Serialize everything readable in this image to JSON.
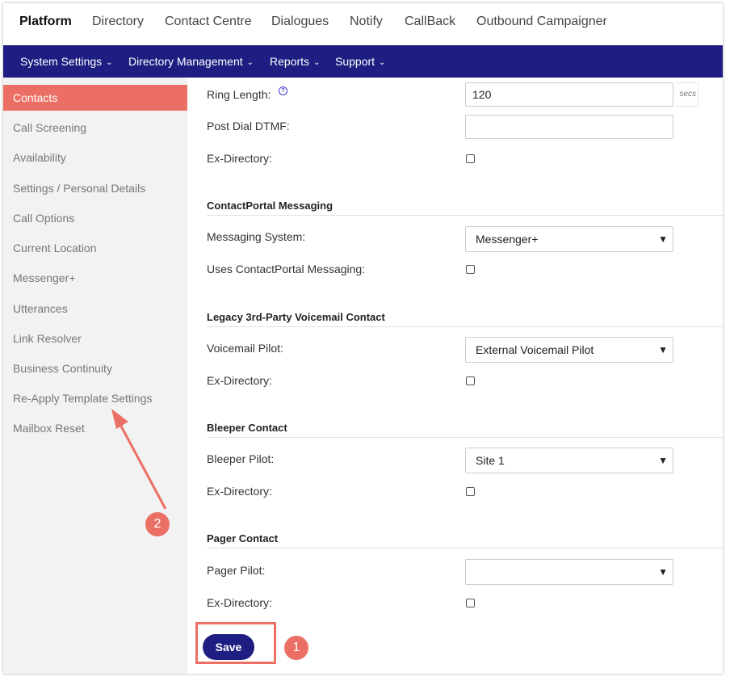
{
  "top_nav": [
    {
      "label": "Platform",
      "active": true
    },
    {
      "label": "Directory"
    },
    {
      "label": "Contact Centre"
    },
    {
      "label": "Dialogues"
    },
    {
      "label": "Notify"
    },
    {
      "label": "CallBack"
    },
    {
      "label": "Outbound Campaigner"
    }
  ],
  "sub_nav": [
    {
      "label": "System Settings"
    },
    {
      "label": "Directory Management"
    },
    {
      "label": "Reports"
    },
    {
      "label": "Support"
    }
  ],
  "sidebar": {
    "items": [
      {
        "label": "Contacts",
        "active": true
      },
      {
        "label": "Call Screening"
      },
      {
        "label": "Availability"
      },
      {
        "label": "Settings / Personal Details"
      },
      {
        "label": "Call Options"
      },
      {
        "label": "Current Location"
      },
      {
        "label": "Messenger+"
      },
      {
        "label": "Utterances"
      },
      {
        "label": "Link Resolver"
      },
      {
        "label": "Business Continuity"
      },
      {
        "label": "Re-Apply Template Settings"
      },
      {
        "label": "Mailbox Reset"
      }
    ]
  },
  "form": {
    "ring_length": {
      "label": "Ring Length:",
      "value": "120",
      "unit": "secs",
      "help_glyph": "?"
    },
    "post_dial_dtmf": {
      "label": "Post Dial DTMF:",
      "value": ""
    },
    "ex_directory_1": {
      "label": "Ex-Directory:",
      "checked": false
    },
    "contactportal": {
      "heading": "ContactPortal Messaging",
      "messaging_system": {
        "label": "Messaging System:",
        "value": "Messenger+"
      },
      "uses_messaging": {
        "label": "Uses ContactPortal Messaging:",
        "checked": false
      }
    },
    "legacy_voicemail": {
      "heading": "Legacy 3rd-Party Voicemail Contact",
      "voicemail_pilot": {
        "label": "Voicemail Pilot:",
        "value": "External Voicemail Pilot"
      },
      "ex_directory": {
        "label": "Ex-Directory:",
        "checked": false
      }
    },
    "bleeper": {
      "heading": "Bleeper Contact",
      "bleeper_pilot": {
        "label": "Bleeper Pilot:",
        "value": "Site 1"
      },
      "ex_directory": {
        "label": "Ex-Directory:",
        "checked": false
      }
    },
    "pager": {
      "heading": "Pager Contact",
      "pager_pilot": {
        "label": "Pager Pilot:",
        "value": ""
      },
      "ex_directory": {
        "label": "Ex-Directory:",
        "checked": false
      }
    },
    "save_label": "Save"
  },
  "annotations": {
    "badge_1": "1",
    "badge_2": "2",
    "accent_color": "#ec6f65"
  },
  "colors": {
    "nav_bar": "#1e1e82",
    "active_sidebar": "#ec6f65",
    "sidebar_bg": "#f2f2f2"
  }
}
